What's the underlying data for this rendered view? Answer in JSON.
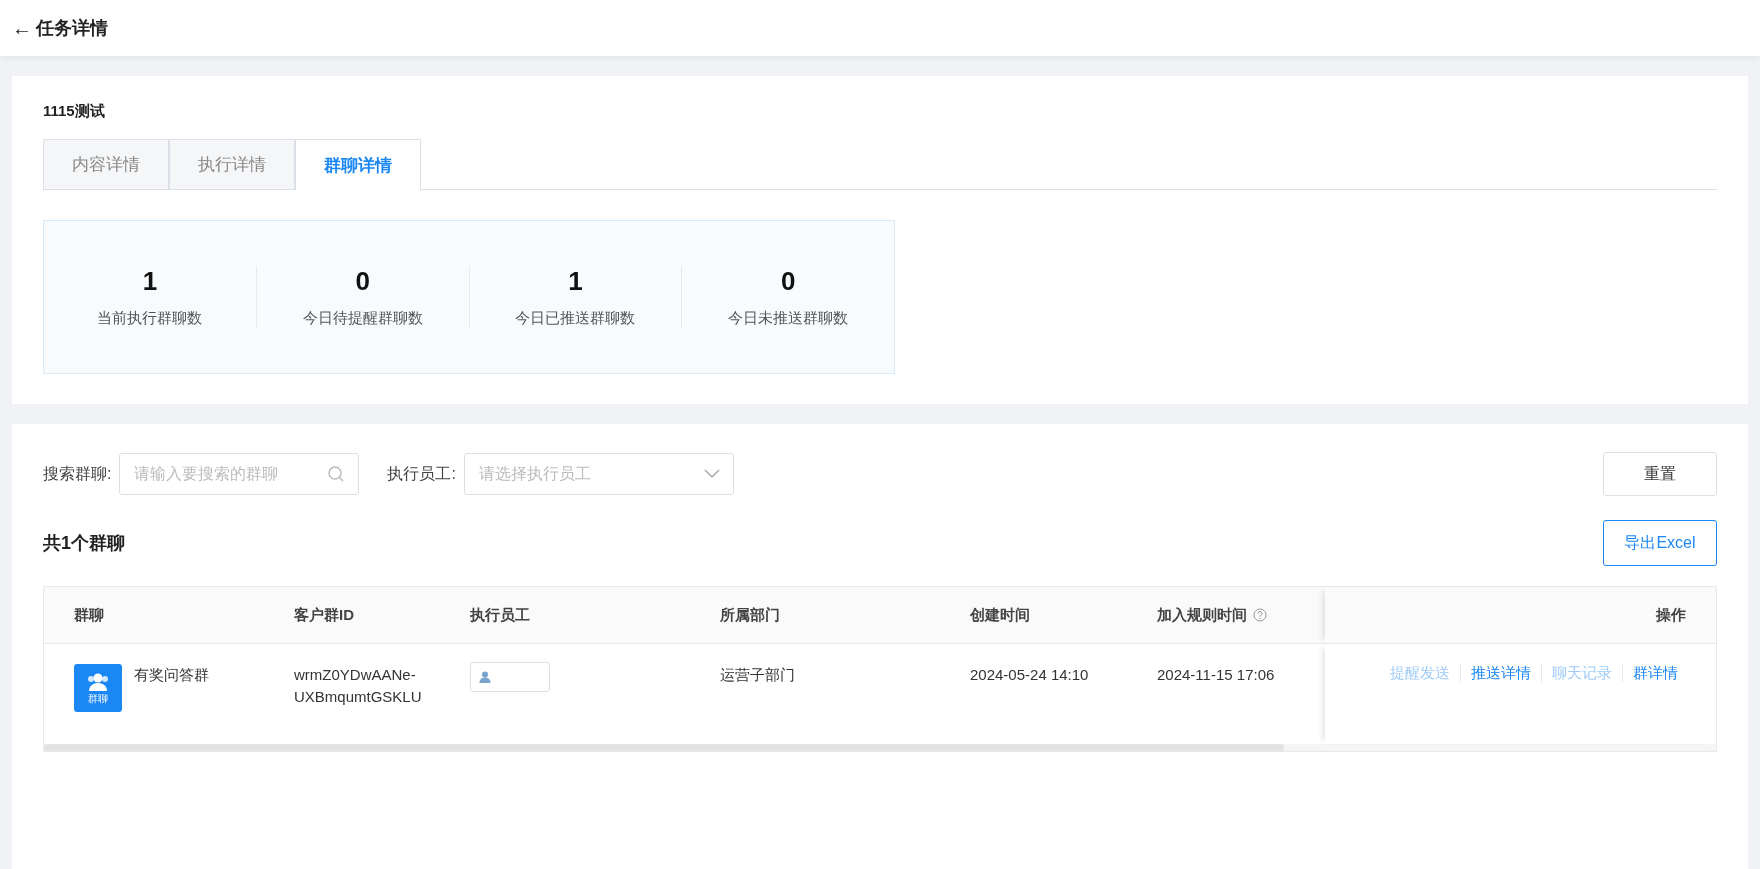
{
  "header": {
    "back_icon": "←",
    "title": "任务详情"
  },
  "task": {
    "name": "1115测试"
  },
  "tabs": [
    {
      "label": "内容详情",
      "selected": false
    },
    {
      "label": "执行详情",
      "selected": false
    },
    {
      "label": "群聊详情",
      "selected": true
    }
  ],
  "stats": [
    {
      "value": "1",
      "label": "当前执行群聊数"
    },
    {
      "value": "0",
      "label": "今日待提醒群聊数"
    },
    {
      "value": "1",
      "label": "今日已推送群聊数"
    },
    {
      "value": "0",
      "label": "今日未推送群聊数"
    }
  ],
  "filters": {
    "search_label": "搜索群聊:",
    "search_placeholder": "请输入要搜索的群聊",
    "staff_label": "执行员工:",
    "staff_placeholder": "请选择执行员工",
    "reset_button": "重置"
  },
  "summary": "共1个群聊",
  "export_button": "导出Excel",
  "table": {
    "columns": [
      "群聊",
      "客户群ID",
      "执行员工",
      "所属部门",
      "创建时间",
      "加入规则时间",
      "操作"
    ],
    "rows": [
      {
        "avatar_label": "群聊",
        "name": "有奖问答群",
        "group_id": "wrmZ0YDwAANe-UXBmqumtGSKLU",
        "department": "运营子部门",
        "created": "2024-05-24 14:10",
        "joined": "2024-11-15 17:06",
        "actions": [
          {
            "label": "提醒发送",
            "disabled": true
          },
          {
            "label": "推送详情",
            "disabled": false
          },
          {
            "label": "聊天记录",
            "disabled": true
          },
          {
            "label": "群详情",
            "disabled": false
          }
        ]
      }
    ]
  }
}
